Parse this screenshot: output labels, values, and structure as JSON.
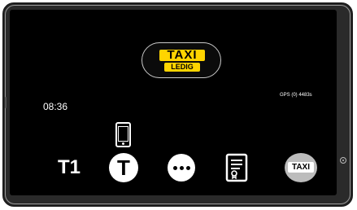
{
  "badge": {
    "title": "TAXI",
    "status": "LEDIG",
    "accent": "#ffd400"
  },
  "status_bar": {
    "clock": "08:36",
    "gps": "GPS (0) 4483s"
  },
  "bottom_bar": {
    "items": [
      {
        "name": "T1",
        "label": "T1"
      },
      {
        "name": "taxameter",
        "label": "T",
        "icon": "t-circle-icon"
      },
      {
        "name": "more",
        "icon": "ellipsis-circle-icon"
      },
      {
        "name": "receipt",
        "icon": "document-certificate-icon"
      },
      {
        "name": "taxi",
        "label": "TAXI",
        "icon": "taxi-roof-sign-icon"
      }
    ]
  },
  "indicators": {
    "phone": "smartphone-icon"
  }
}
